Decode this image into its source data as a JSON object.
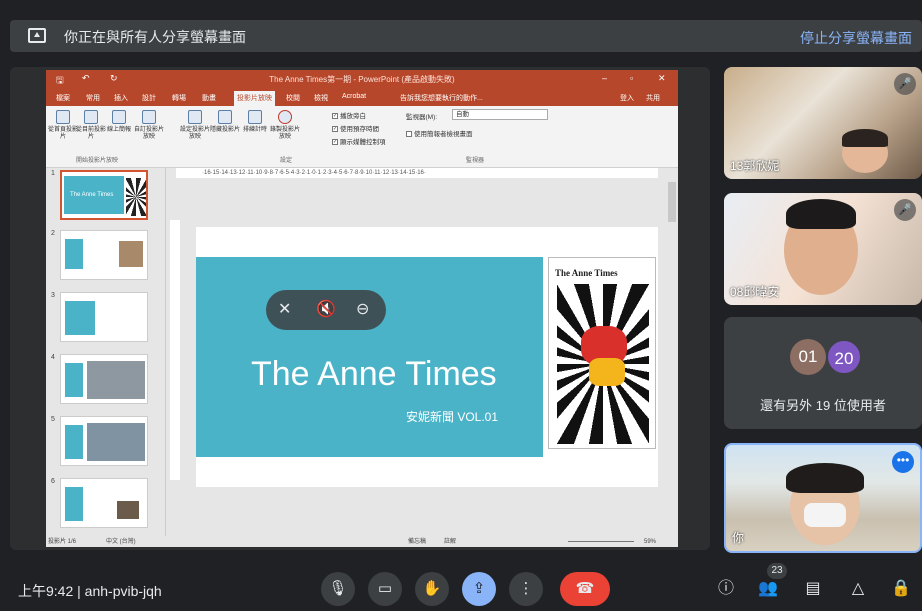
{
  "banner": {
    "message": "你正在與所有人分享螢幕畫面",
    "stop": "停止分享螢幕畫面"
  },
  "powerpoint": {
    "window_title": "The Anne Times第一期 - PowerPoint (產品啟動失敗)",
    "tabs": [
      "檔案",
      "常用",
      "插入",
      "設計",
      "轉場",
      "動畫",
      "投影片放映",
      "校閱",
      "檢視",
      "Acrobat"
    ],
    "selected_tab": "投影片放映",
    "tell_me": "告訴我您想要執行的動作...",
    "user": "登入",
    "share": "共用",
    "ribbon_buttons": [
      "從首頁投影片",
      "從目前投影片",
      "線上簡報",
      "自訂投影片放映",
      "設定投影片放映",
      "隱藏投影片",
      "排練計時",
      "錄製投影片放映"
    ],
    "group_labels": [
      "開始投影片放映",
      "設定",
      "監視器"
    ],
    "checks": [
      "播放旁白",
      "使用預存時間",
      "顯示媒體控制項",
      "使用簡報者檢視畫面"
    ],
    "monitor_label": "監視器(M):",
    "monitor_value": "自動",
    "ruler_text": "·16·15·14·13·12·11·10·9·8·7·6·5·4·3·2·1·0·1·2·3·4·5·6·7·8·9·10·11·12·13·14·15·16·",
    "thumb_numbers": [
      "1",
      "2",
      "3",
      "4",
      "5",
      "6"
    ],
    "thumb1_title": "The Anne Times",
    "slide_title": "The Anne Times",
    "slide_subtitle": "安妮新聞 VOL.01",
    "cover_title": "The Anne Times",
    "status": {
      "slide_count": "投影片 1/6",
      "language": "中文 (台灣)",
      "notes": "備忘稿",
      "comments": "註解",
      "zoom": "59%"
    }
  },
  "overlay_icons": [
    "pin-off-icon",
    "mute-icon",
    "remove-icon"
  ],
  "participants": [
    {
      "name": "13郭欣妮",
      "muted": true
    },
    {
      "name": "08邱暐安",
      "muted": true
    },
    {
      "name": "你",
      "muted": false
    }
  ],
  "others": {
    "avatar1": "01",
    "avatar2": "20",
    "text": "還有另外 19 位使用者",
    "color1": "#8d6e63",
    "color2": "#7e57c2"
  },
  "bottom": {
    "time": "上午9:42",
    "meeting_code": "anh-pvib-jqh",
    "people_count": "23"
  },
  "colors": {
    "accent": "#8ab4f8",
    "end_call": "#ea4335",
    "ppt": "#b7472a",
    "slide": "#4bb3c8"
  }
}
